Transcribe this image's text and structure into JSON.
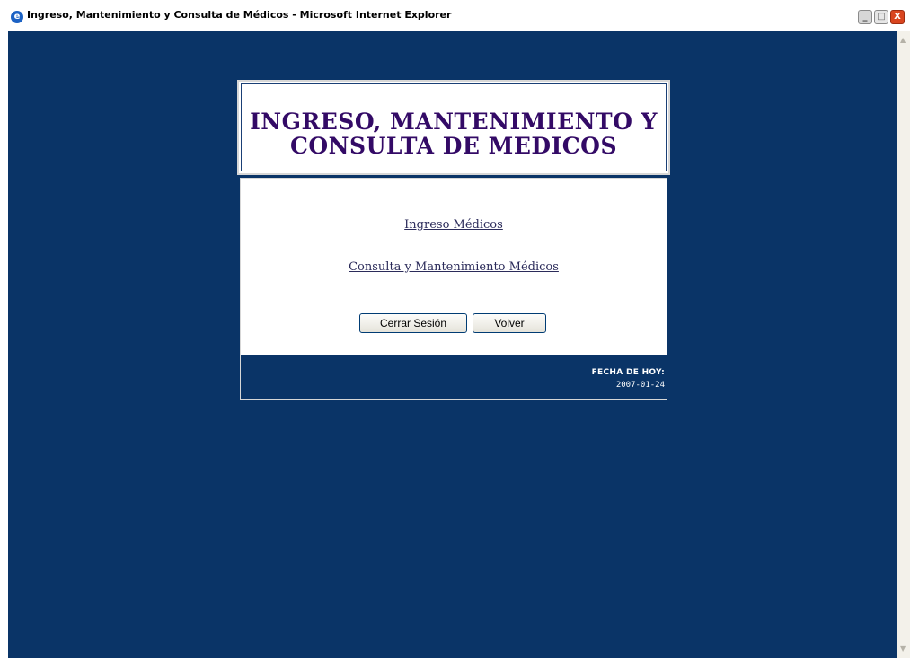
{
  "window": {
    "title": "Ingreso, Mantenimiento y Consulta de Médicos - Microsoft Internet Explorer",
    "icon": "internet-explorer-icon",
    "controls": {
      "minimize": "_",
      "maximize": "□",
      "close": "X"
    }
  },
  "header": {
    "title": "INGRESO, MANTENIMIENTO Y CONSULTA DE MEDICOS"
  },
  "menu": {
    "links": [
      "Ingreso Médicos",
      "Consulta y Mantenimiento Médicos"
    ]
  },
  "actions": {
    "logout_label": "Cerrar Sesión",
    "back_label": "Volver"
  },
  "footer": {
    "date_label": "FECHA DE HOY:",
    "date_value": "2007-01-24"
  },
  "colors": {
    "page_background": "#0a3467",
    "title_text": "#330a66",
    "link_text": "#2b2b5a",
    "panel_background": "#ffffff"
  }
}
